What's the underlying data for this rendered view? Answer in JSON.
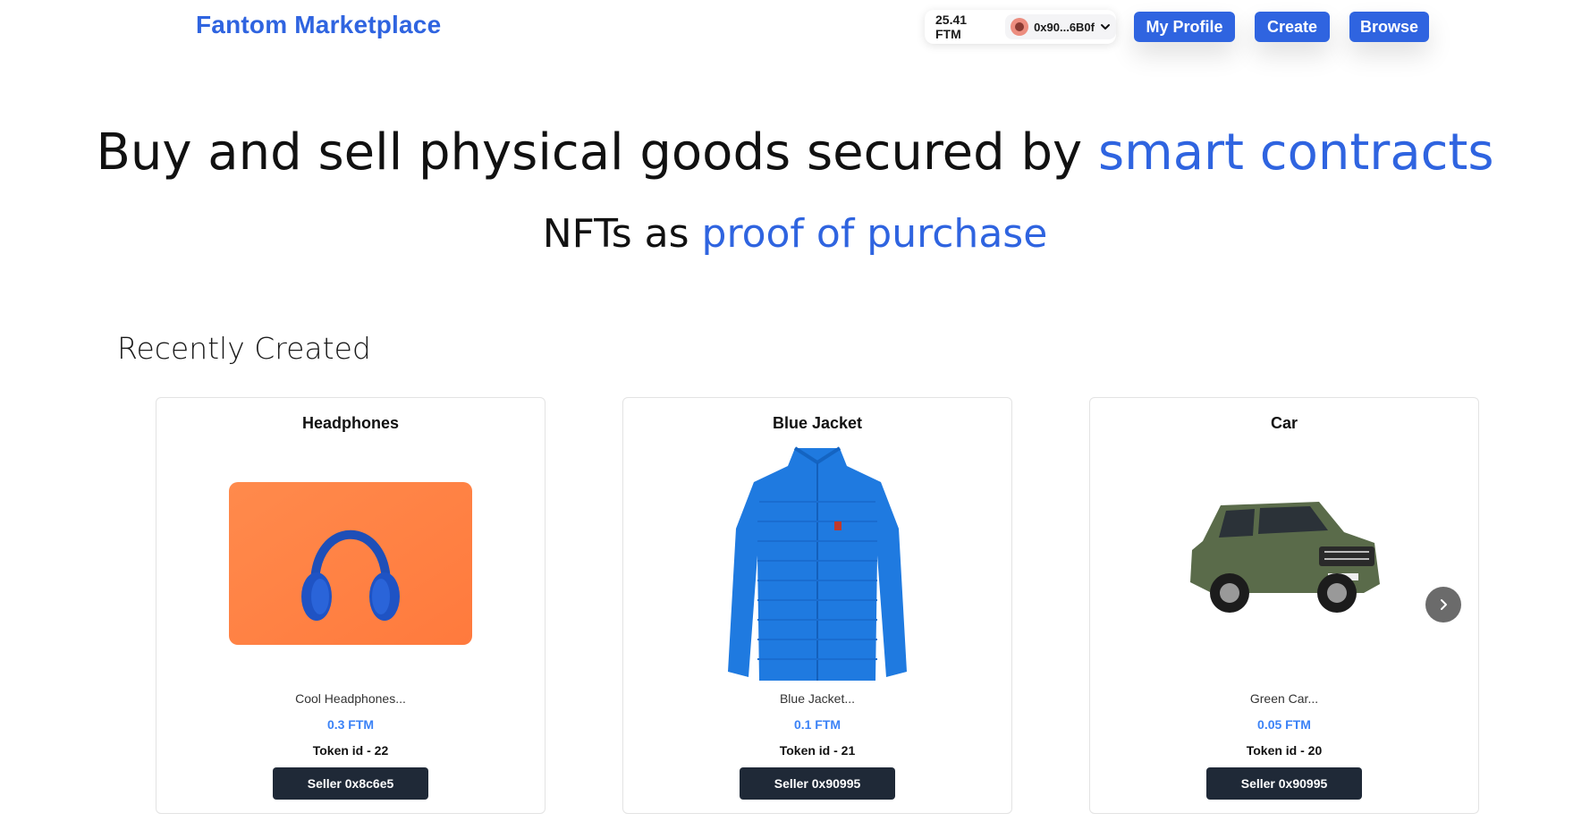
{
  "header": {
    "brand": "Fantom Marketplace",
    "balance": "25.41 FTM",
    "address": "0x90...6B0f",
    "nav": {
      "my_profile": "My Profile",
      "create": "Create",
      "browse": "Browse"
    }
  },
  "hero": {
    "line1_text": "Buy and sell physical goods secured by ",
    "line1_accent": "smart contracts",
    "line2_text": "NFTs as ",
    "line2_accent": "proof of purchase"
  },
  "section": {
    "title": "Recently Created"
  },
  "cards": [
    {
      "title": "Headphones",
      "description": "Cool Headphones...",
      "price": "0.3 FTM",
      "token": "Token id - 22",
      "seller": "Seller 0x8c6e5"
    },
    {
      "title": "Blue Jacket",
      "description": "Blue Jacket...",
      "price": "0.1 FTM",
      "token": "Token id - 21",
      "seller": "Seller 0x90995"
    },
    {
      "title": "Car",
      "description": "Green Car...",
      "price": "0.05 FTM",
      "token": "Token id - 20",
      "seller": "Seller 0x90995"
    }
  ],
  "colors": {
    "accent": "#2f64e0",
    "price": "#3b82f6",
    "seller_button": "#1f2937"
  },
  "icons": {
    "wallet_dropdown": "chevron-down-icon",
    "carousel_next": "chevron-right-icon"
  }
}
